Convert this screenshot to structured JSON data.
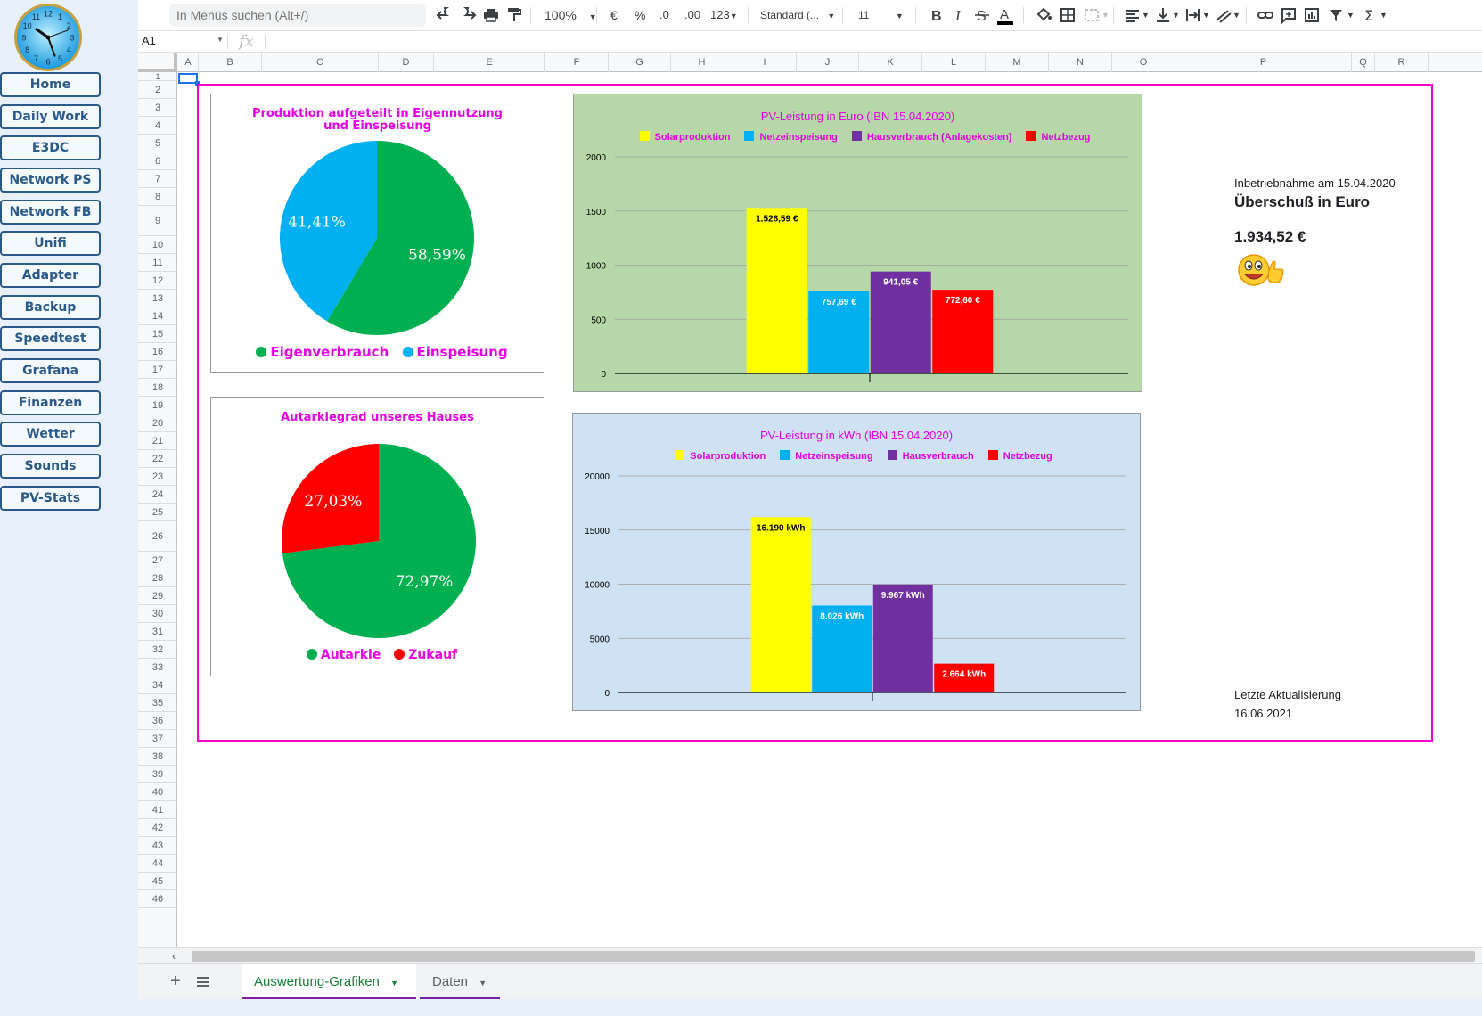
{
  "nav": {
    "items": [
      "Home",
      "Daily Work",
      "E3DC",
      "Network PS",
      "Network FB",
      "Unifi",
      "Adapter",
      "Backup",
      "Speedtest",
      "Grafana",
      "Finanzen",
      "Wetter",
      "Sounds",
      "PV-Stats"
    ]
  },
  "clock": {
    "numerals": [
      "12",
      "1",
      "2",
      "3",
      "4",
      "5",
      "6",
      "7",
      "8",
      "9",
      "10",
      "11"
    ]
  },
  "toolbar": {
    "search_placeholder": "In Menüs suchen (Alt+/)",
    "zoom": "100%",
    "currency": "€",
    "percent": "%",
    "dec_less": ".0",
    "dec_more": ".00",
    "format_more": "123",
    "font": "Standard (...",
    "font_size": "11"
  },
  "formula": {
    "cell_ref": "A1",
    "fx": "fx"
  },
  "columns": [
    "A",
    "B",
    "C",
    "D",
    "E",
    "F",
    "G",
    "H",
    "I",
    "J",
    "K",
    "L",
    "M",
    "N",
    "O",
    "P",
    "Q",
    "R"
  ],
  "rows": [
    "1",
    "2",
    "3",
    "4",
    "5",
    "6",
    "7",
    "8",
    "9",
    "10",
    "11",
    "12",
    "13",
    "14",
    "15",
    "16",
    "17",
    "18",
    "19",
    "20",
    "21",
    "22",
    "23",
    "24",
    "25",
    "26",
    "27",
    "28",
    "29",
    "30",
    "31",
    "32",
    "33",
    "34",
    "35",
    "36",
    "37",
    "38",
    "39",
    "40",
    "41",
    "42",
    "43",
    "44",
    "45",
    "46"
  ],
  "info": {
    "date_label": "Inbetriebnahme am 15.04.2020",
    "title": "Überschuß in Euro",
    "value": "1.934,52 €",
    "update_label": "Letzte Aktualisierung",
    "update_date": "16.06.2021"
  },
  "sheets": {
    "active": "Auswertung-Grafiken",
    "other": "Daten"
  },
  "colors": {
    "green": "#00b050",
    "blue": "#00b0f0",
    "red": "#ff0000",
    "yellow": "#ffff00",
    "purple": "#7030a0",
    "magenta": "#e600e6"
  },
  "chart_data": [
    {
      "type": "pie",
      "title": "Produktion aufgeteilt in Eigennutzung und Einspeisung",
      "labels": [
        "Eigenverbrauch",
        "Einspeisung"
      ],
      "values": [
        58.59,
        41.41
      ],
      "value_labels": [
        "58,59%",
        "41,41%"
      ],
      "colors": [
        "#00b050",
        "#00b0f0"
      ],
      "legend": "bottom"
    },
    {
      "type": "pie",
      "title": "Autarkiegrad unseres Hauses",
      "labels": [
        "Autarkie",
        "Zukauf"
      ],
      "values": [
        72.97,
        27.03
      ],
      "value_labels": [
        "72,97%",
        "27,03%"
      ],
      "colors": [
        "#00b050",
        "#ff0000"
      ],
      "legend": "bottom"
    },
    {
      "type": "bar",
      "title": "PV-Leistung in Euro (IBN 15.04.2020)",
      "series": [
        {
          "name": "Solarproduktion",
          "value": 1528.59,
          "label": "1.528,59 €",
          "color": "#ffff00"
        },
        {
          "name": "Netzeinspeisung",
          "value": 757.69,
          "label": "757,69 €",
          "color": "#00b0f0"
        },
        {
          "name": "Hausverbrauch (Anlagekosten)",
          "value": 941.05,
          "label": "941,05 €",
          "color": "#7030a0"
        },
        {
          "name": "Netzbezug",
          "value": 772.6,
          "label": "772,60 €",
          "color": "#ff0000"
        }
      ],
      "ylim": [
        0,
        2000
      ],
      "yticks": [
        0,
        500,
        1000,
        1500,
        2000
      ],
      "legend": "top",
      "background": "#b6d7a8"
    },
    {
      "type": "bar",
      "title": "PV-Leistung in kWh (IBN 15.04.2020)",
      "series": [
        {
          "name": "Solarproduktion",
          "value": 16190,
          "label": "16.190 kWh",
          "color": "#ffff00"
        },
        {
          "name": "Netzeinspeisung",
          "value": 8026,
          "label": "8.026 kWh",
          "color": "#00b0f0"
        },
        {
          "name": "Hausverbrauch",
          "value": 9967,
          "label": "9.967 kWh",
          "color": "#7030a0"
        },
        {
          "name": "Netzbezug",
          "value": 2664,
          "label": "2.664 kWh",
          "color": "#ff0000"
        }
      ],
      "ylim": [
        0,
        20000
      ],
      "yticks": [
        0,
        5000,
        10000,
        15000,
        20000
      ],
      "legend": "top",
      "background": "#cfe2f3"
    }
  ]
}
